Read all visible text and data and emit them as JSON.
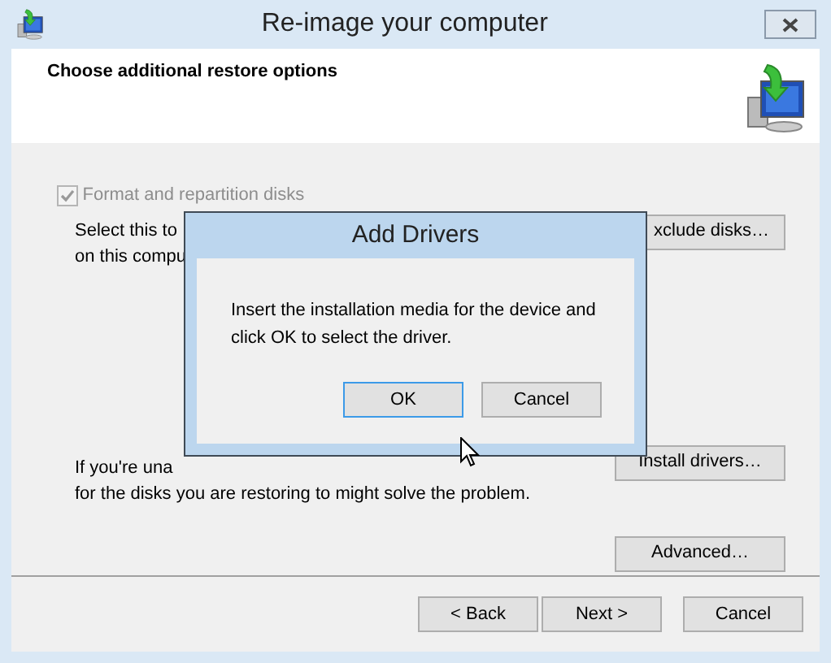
{
  "window": {
    "title": "Re-image your computer"
  },
  "header": {
    "heading": "Choose additional restore options"
  },
  "options": {
    "format_checkbox": {
      "label": "Format and repartition disks",
      "checked": true,
      "disabled": true
    },
    "format_description": [
      "Select this to",
      "on this compu"
    ],
    "exclude_button": "xclude disks…",
    "drivers_description": [
      "If you're una",
      "for the disks you are restoring to might solve the problem."
    ],
    "install_button": "Install drivers…",
    "advanced_button": "Advanced…"
  },
  "buttons": [
    {
      "label": "< Back",
      "default": false
    },
    {
      "label": "Next >",
      "default": false
    },
    {
      "label": "Cancel",
      "default": false
    }
  ],
  "dialog": {
    "title": "Add Drivers",
    "message": "Insert the installation media for the device and click OK to select the driver.",
    "buttons": [
      {
        "label": "OK",
        "default": true
      },
      {
        "label": "Cancel",
        "default": false
      }
    ]
  }
}
